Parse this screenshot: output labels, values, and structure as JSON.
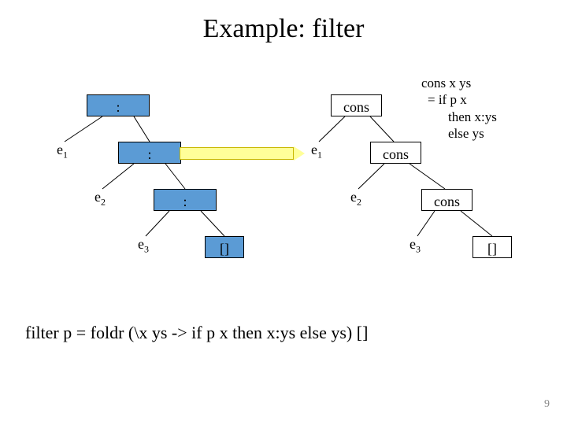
{
  "title": "Example: filter",
  "left": {
    "n1": ":",
    "e1": "e",
    "n2": ":",
    "e2": "e",
    "n3": ":",
    "e3": "e",
    "nil": "[]"
  },
  "right": {
    "n1": "cons",
    "e1": "e",
    "n2": "cons",
    "e2": "e",
    "n3": "cons",
    "e3": "e",
    "nil": "[]"
  },
  "code": {
    "l1": "cons x ys",
    "l2": "= if p x",
    "l3": "then x:ys",
    "l4": "else ys"
  },
  "bottom": "filter p = foldr (\\x ys -> if p x then x:ys else ys) []",
  "page": "9"
}
